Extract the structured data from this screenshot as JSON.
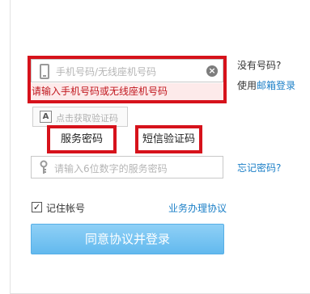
{
  "login": {
    "phone_placeholder": "手机号码/无线座机号码",
    "clear_symbol": "×",
    "error_tip": "请输入手机号码或无线座机号码",
    "no_account": "没有号码?",
    "use_prefix": "使用",
    "email_login": "邮箱登录",
    "captcha_label": "点击获取验证码",
    "captcha_glyph": "A",
    "tabs": [
      {
        "label": "服务密码"
      },
      {
        "label": "短信验证码"
      }
    ],
    "password_placeholder": "请输入6位数字的服务密码",
    "forgot_password": "忘记密码?",
    "remember_label": "记住帐号",
    "remember_checked": "✓",
    "agreement": "业务办理协议",
    "submit_label": "同意协议并登录"
  },
  "colors": {
    "highlight": "#d6121b",
    "link": "#1b7fc7",
    "button": "#62b9ee",
    "error_bg": "#fdeaea"
  }
}
